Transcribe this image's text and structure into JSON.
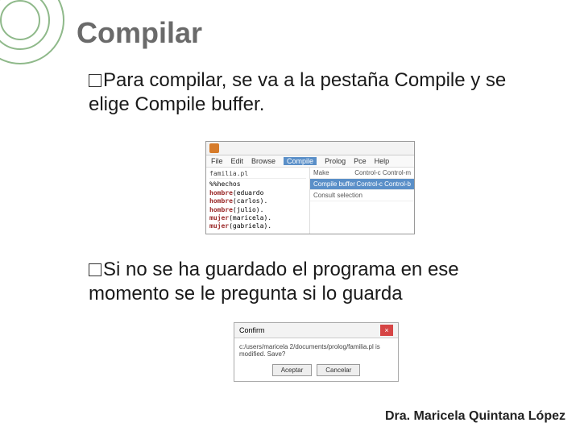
{
  "title": "Compilar",
  "p1": {
    "bullet_prefix": "Para",
    "rest": " compilar, se va a la pestaña Compile y se elige Compile buffer."
  },
  "editor": {
    "menu": {
      "file": "File",
      "edit": "Edit",
      "browse": "Browse",
      "compile": "Compile",
      "prolog": "Prolog",
      "pce": "Pce",
      "help": "Help"
    },
    "dropdown": {
      "make": "Make",
      "make_sc": "Control-c Control-m",
      "compile_buffer": "Compile buffer",
      "compile_sc": "Control-c Control-b",
      "consult": "Consult selection"
    },
    "filename": "familia.pl",
    "code": {
      "c0": "%%hechos",
      "k1": "hombre",
      "a1": "(eduardo",
      "k2": "hombre",
      "a2": "(carlos).",
      "k3": "hombre",
      "a3": "(julio).",
      "k4": "mujer",
      "a4": "(maricela).",
      "k5": "mujer",
      "a5": "(gabriela)."
    }
  },
  "p2": {
    "bullet_prefix": "Si",
    "rest": " no se ha guardado el programa en ese momento se le pregunta si lo guarda"
  },
  "dialog": {
    "title": "Confirm",
    "message": "c:/users/maricela 2/documents/prolog/familia.pl is modified. Save?",
    "accept": "Aceptar",
    "cancel": "Cancelar"
  },
  "footer": "Dra. Maricela Quintana López"
}
